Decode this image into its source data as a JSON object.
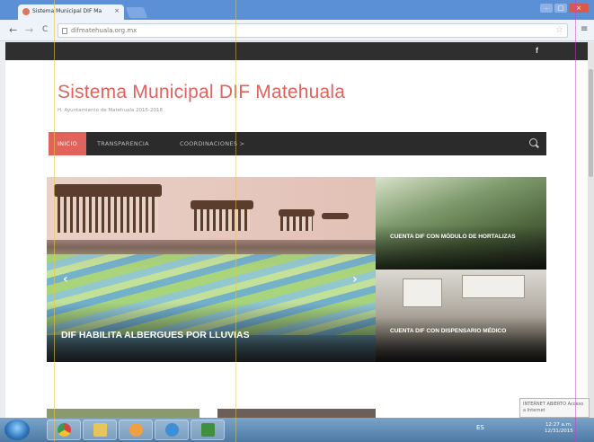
{
  "browser": {
    "tab_title": "Sistema Municipal DIF Ma",
    "tab_close": "×",
    "url": "difmatehuala.org.mx",
    "back": "←",
    "forward": "→",
    "reload": "C",
    "star": "☆",
    "menu": "≡",
    "window_buttons": [
      "–",
      "□",
      "×"
    ]
  },
  "site": {
    "facebook": "f",
    "title": "Sistema Municipal DIF Matehuala",
    "tagline": "H. Ayuntamiento de Matehuala 2015-2018",
    "nav": {
      "items": [
        "INICIO",
        "TRANSPARENCIA",
        "COORDINACIONES >"
      ]
    }
  },
  "slider": {
    "caption": "DIF HABILITA ALBERGUES POR LLUVIAS",
    "prev": "‹",
    "next": "›"
  },
  "side_cards": [
    {
      "caption": "CUENTA DIF CON MÓDULO DE HORTALIZAS"
    },
    {
      "caption": "CUENTA DIF CON DISPENSARIO MÉDICO"
    }
  ],
  "taskbar": {
    "tray_text": "ES",
    "clock_time": "12:27 a.m.",
    "clock_date": "12/31/2015",
    "tooltip": "INTERNET ABIERTO Acceso a Internet"
  },
  "colors": {
    "accent": "#e2625c",
    "nav_bg": "#2b2b2b",
    "topbar_bg": "#2f2f2f"
  }
}
